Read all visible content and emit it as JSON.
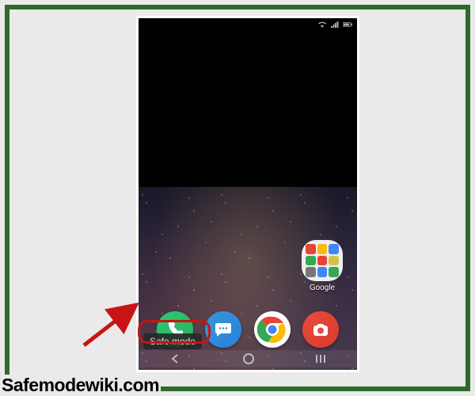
{
  "folder": {
    "label": "Google",
    "mini_colors": [
      "#ea4335",
      "#fbbc05",
      "#4285f4",
      "#34a853",
      "#ea4335",
      "#d6c24a",
      "#777",
      "#4285f4",
      "#34a853"
    ]
  },
  "dock": {
    "phone_name": "phone-app",
    "messages_name": "messages-app",
    "chrome_name": "chrome-app",
    "camera_name": "camera-app"
  },
  "badge": {
    "text": "Safe mode"
  },
  "watermark": "Safemodewiki.com"
}
